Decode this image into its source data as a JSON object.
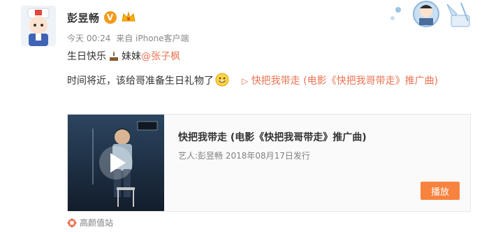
{
  "post": {
    "username": "彭昱畅",
    "verified_badge": "V",
    "time": "今天 00:24",
    "source": "来自 iPhone客户端",
    "line1_prefix": "生日快乐",
    "line1_mid": "妹妹",
    "mention": "@张子枫",
    "line2_text": "时间将近，该给哥准备生日礼物了",
    "link_icon": "▷",
    "link_text": "快把我带走 (电影《快把我哥带走》推广曲)"
  },
  "music_card": {
    "title": "快把我带走 (电影《快把我哥带走》推广曲)",
    "artist": "艺人:彭昱畅 2018年08月17日发行",
    "play_label": "播放"
  },
  "footer": {
    "label": "高颜值站"
  },
  "colors": {
    "accent": "#eb7350",
    "play_button": "#f7833f",
    "verified": "#f29a1b"
  }
}
